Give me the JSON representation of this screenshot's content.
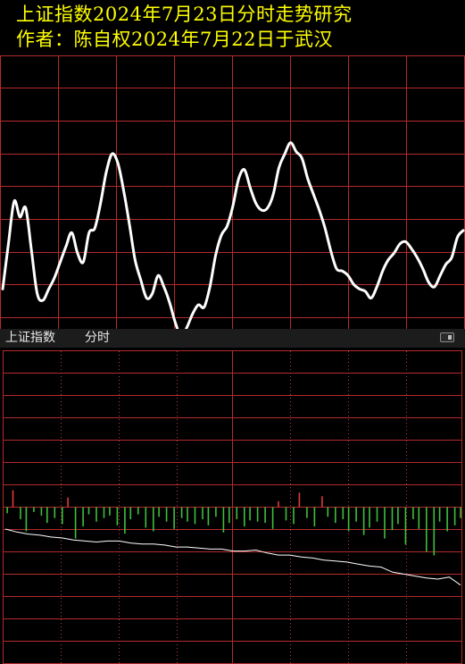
{
  "header": {
    "title": "上证指数2024年7月23日分时走势研究",
    "subtitle": "作者：陈自权2024年7月22日于武汉"
  },
  "panel": {
    "index_name": "上证指数",
    "view_name": "分时"
  },
  "colors": {
    "background": "#000000",
    "title": "#ffff00",
    "grid": "#b52a2a",
    "grid_dotted": "#c23b3b",
    "forecast_line": "#ffffff",
    "price_line": "#ffffff",
    "up_bar": "#e03a3a",
    "down_bar": "#3fbf3f"
  },
  "chart_data": [
    {
      "type": "line",
      "description_role": "hand-drawn forecast curve (upper panel, no axis labels shown)",
      "x": [
        0,
        3,
        6,
        9,
        12,
        15,
        18,
        21,
        24,
        27,
        30,
        33,
        36,
        39,
        42,
        45,
        48,
        51,
        54,
        57,
        60,
        63,
        66,
        69,
        72,
        75,
        78,
        81,
        84,
        87,
        90,
        93,
        96,
        99,
        102,
        105,
        108,
        111,
        114,
        117,
        120,
        123,
        126,
        129,
        132,
        135,
        138,
        141,
        144,
        147,
        150,
        153,
        156,
        159,
        162,
        165,
        168,
        171,
        174,
        177,
        180,
        183,
        186,
        189,
        192,
        195,
        198,
        201,
        204,
        207,
        210,
        213,
        216,
        219,
        222,
        225,
        228,
        231,
        234,
        237,
        240
      ],
      "y": [
        72,
        52,
        33,
        40,
        36,
        55,
        74,
        77,
        72,
        67,
        60,
        53,
        47,
        56,
        60,
        47,
        45,
        34,
        20,
        12,
        16,
        28,
        43,
        59,
        68,
        76,
        74,
        66,
        71,
        78,
        87,
        93,
        89,
        83,
        79,
        80,
        71,
        57,
        48,
        44,
        35,
        23,
        19,
        27,
        34,
        37,
        36,
        30,
        18,
        12,
        7,
        11,
        14,
        23,
        30,
        37,
        45,
        55,
        63,
        64,
        66,
        70,
        72,
        73,
        76,
        71,
        64,
        59,
        56,
        52,
        51,
        54,
        58,
        63,
        69,
        71,
        66,
        61,
        58,
        49,
        46
      ]
    },
    {
      "type": "line",
      "description_role": "intraday price line (lower panel, no axis labels shown)",
      "x": [
        0,
        6,
        12,
        18,
        24,
        30,
        36,
        42,
        48,
        54,
        60,
        66,
        72,
        78,
        84,
        90,
        96,
        102,
        108,
        114,
        120,
        126,
        132,
        138,
        144,
        150,
        156,
        162,
        168,
        174,
        180,
        186,
        192,
        198,
        204,
        210,
        216,
        222,
        228,
        234,
        240
      ],
      "y": [
        92,
        89,
        87,
        86,
        84,
        83,
        81,
        80,
        79,
        80,
        80,
        78,
        77,
        77,
        76,
        74,
        74,
        73,
        72,
        72,
        70,
        70,
        71,
        68,
        66,
        66,
        64,
        63,
        61,
        60,
        59,
        57,
        55,
        54,
        49,
        47,
        45,
        43,
        42,
        44,
        36
      ]
    },
    {
      "type": "bar",
      "description_role": "intraday buy/sell volume bars (lower panel, positive = red up bar, negative = green down bar)",
      "x": [
        1,
        4,
        8,
        11,
        15,
        19,
        22,
        26,
        30,
        33,
        37,
        41,
        44,
        48,
        52,
        55,
        59,
        63,
        66,
        70,
        74,
        78,
        81,
        85,
        89,
        93,
        96,
        100,
        104,
        107,
        111,
        115,
        118,
        122,
        126,
        129,
        133,
        137,
        141,
        144,
        148,
        152,
        155,
        159,
        163,
        167,
        170,
        174,
        178,
        181,
        185,
        189,
        192,
        196,
        200,
        204,
        207,
        211,
        215,
        218,
        222,
        226,
        229,
        233,
        237,
        240
      ],
      "values": [
        -5,
        14,
        -10,
        -20,
        -4,
        -7,
        -13,
        -9,
        -14,
        8,
        -26,
        -16,
        -6,
        -12,
        -9,
        -7,
        -15,
        -22,
        -10,
        -6,
        -17,
        -20,
        -8,
        -12,
        -18,
        -9,
        -12,
        -14,
        -10,
        -15,
        -8,
        -21,
        -13,
        -10,
        -16,
        -11,
        -12,
        -13,
        -18,
        5,
        -11,
        -14,
        12,
        -9,
        -16,
        9,
        -8,
        -13,
        -10,
        -20,
        -12,
        -23,
        -17,
        -12,
        -26,
        -19,
        -14,
        -31,
        -10,
        -18,
        -37,
        -40,
        -12,
        -20,
        -15,
        -9
      ]
    }
  ]
}
